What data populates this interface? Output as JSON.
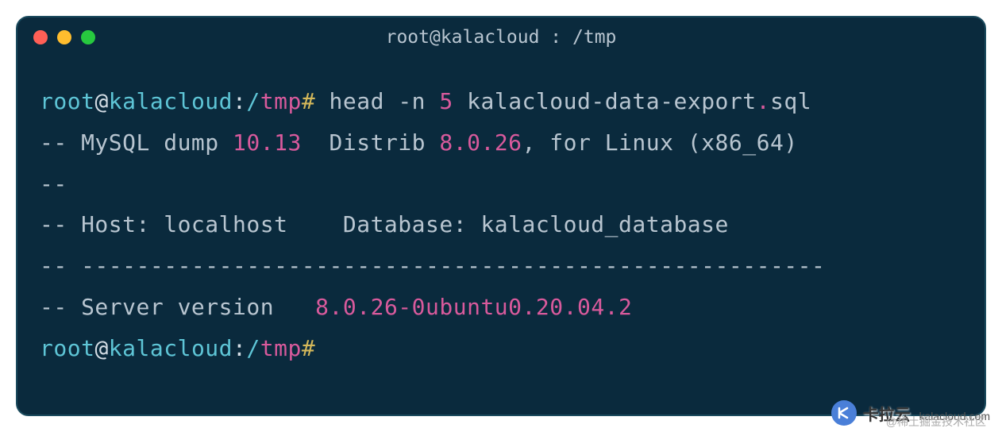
{
  "window": {
    "title": "root@kalacloud : /tmp"
  },
  "prompt1": {
    "user": "root",
    "at": "@",
    "host": "kalacloud",
    "colon": ":",
    "slash": "/",
    "path": "tmp",
    "hash": "# ",
    "cmd": "head ",
    "flag": "-n ",
    "num": "5 ",
    "file": "kalacloud-data-export",
    "dot": ".",
    "ext": "sql"
  },
  "output": {
    "line1_pre": "-- MySQL dump ",
    "line1_ver": "10.13",
    "line1_mid": "  Distrib ",
    "line1_ver2": "8.0",
    "line1_dot": ".",
    "line1_patch": "26",
    "line1_post": ", for Linux (x86_64)",
    "line2": "--",
    "line3": "-- Host: localhost    Database: kalacloud_database",
    "line4": "-- ------------------------------------------------------",
    "line5_pre": "-- Server version   ",
    "line5_ver": "8.0",
    "line5_dot": ".",
    "line5_rest": "26-0ubuntu0.20.04.2"
  },
  "prompt2": {
    "user": "root",
    "at": "@",
    "host": "kalacloud",
    "colon": ":",
    "slash": "/",
    "path": "tmp",
    "hash": "#"
  },
  "watermark": {
    "main": "卡拉云",
    "sub": "kalacloud.com",
    "overlay": "@稀土掘金技术社区"
  }
}
